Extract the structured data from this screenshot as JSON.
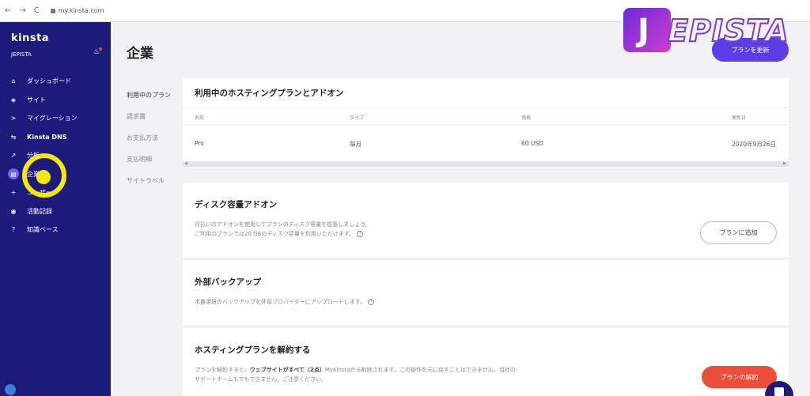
{
  "browser": {
    "back": "←",
    "forward": "→",
    "reload": "C",
    "url": "my.kinsta.com"
  },
  "sidebar": {
    "logo": "kinsta",
    "company": "JEPISTA",
    "items": [
      {
        "label": "ダッシュボード",
        "icon": "⌂"
      },
      {
        "label": "サイト",
        "icon": "◈"
      },
      {
        "label": "マイグレーション",
        "icon": ">"
      },
      {
        "label": "Kinsta DNS",
        "icon": "⇆"
      },
      {
        "label": "分析",
        "icon": "↗"
      },
      {
        "label": "企業",
        "icon": "▤"
      },
      {
        "label": "ユーザー",
        "icon": "+"
      },
      {
        "label": "活動記録",
        "icon": "◉"
      },
      {
        "label": "知識ベース",
        "icon": "?"
      }
    ]
  },
  "watermark": {
    "initial": "J",
    "text": "EPISTA"
  },
  "header": {
    "title": "企業",
    "upgrade_label": "プランを更新"
  },
  "subnav": {
    "items": [
      "利用中のプラン",
      "請求書",
      "お支払方法",
      "支払明細",
      "サイトラベル"
    ]
  },
  "plans": {
    "title": "利用中のホスティングプランとアドオン",
    "columns": [
      "名前",
      "タイプ",
      "価格",
      "更新日"
    ],
    "rows": [
      [
        "Pro",
        "毎月",
        "60 USD",
        "2020年9月26日"
      ]
    ]
  },
  "addon": {
    "title": "ディスク容量アドオン",
    "line1": "月払いのアドオンを使用してプランのディスク容量を拡張しましょう。",
    "line2": "ご利用のプランでは20 GBのディスク容量を利用いただけます。",
    "button": "プランに追加"
  },
  "backup": {
    "title": "外部バックアップ",
    "desc": "本番環境のバックアップを外部プロバイダーにアップロードします。"
  },
  "cancel": {
    "title": "ホスティングプランを解約する",
    "desc_a": "プランを解約すると、",
    "desc_b": "ウェブサイトがすべて（2点）",
    "desc_c": "MyKinstaから削除されます。この操作を元に戻すことはできません。当社の",
    "desc_d": "サポートチームもでもできません。ご注意ください。",
    "button": "プランの解約"
  },
  "colors": {
    "sidebar": "#1c1a7a",
    "accent": "#5b3ee8",
    "danger": "#ec4e3a",
    "highlight": "#f6e800"
  }
}
